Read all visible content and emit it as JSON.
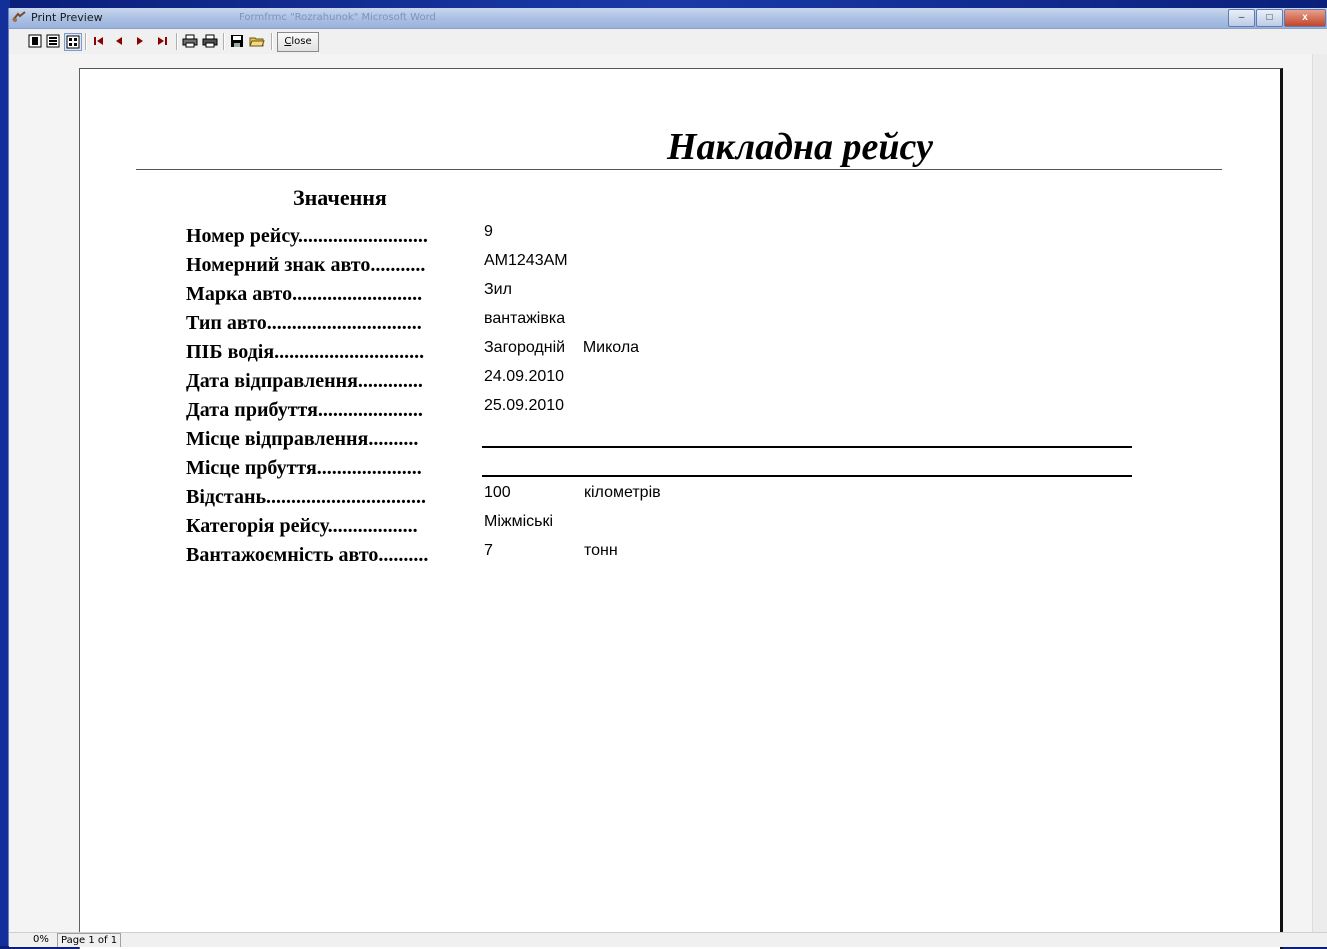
{
  "window": {
    "title": "Print Preview",
    "background_title": "Formfrmc \"Rozrahunok\" Microsoft Word",
    "minimize_label": "–",
    "maximize_label": "□",
    "close_label": "x"
  },
  "toolbar": {
    "close_label_first": "C",
    "close_label_rest": "lose"
  },
  "report": {
    "title": "Накладна рейсу",
    "section_heading": "Значення",
    "fields": [
      {
        "label": "Номер рейсу..........................",
        "value": "9",
        "unit": ""
      },
      {
        "label": "Номерний знак авто...........",
        "value": "АМ1243АМ",
        "unit": ""
      },
      {
        "label": "Марка авто..........................",
        "value": "Зил",
        "unit": ""
      },
      {
        "label": "Тип авто...............................",
        "value": "вантажівка",
        "unit": ""
      },
      {
        "label": "ПІБ водія..............................",
        "value": "Загородній    Микола",
        "unit": ""
      },
      {
        "label": "Дата відправлення.............",
        "value": "24.09.2010",
        "unit": ""
      },
      {
        "label": "Дата прибуття.....................",
        "value": "25.09.2010",
        "unit": ""
      },
      {
        "label": "Місце відправлення..........",
        "value": "",
        "unit": ""
      },
      {
        "label": "Місце прбуття.....................",
        "value": "",
        "unit": ""
      },
      {
        "label": "Відстань................................",
        "value": "100",
        "unit": "кілометрів"
      },
      {
        "label": "Категорія рейсу..................",
        "value": "Міжміські",
        "unit": ""
      },
      {
        "label": "Вантажоємність авто..........",
        "value": "7",
        "unit": "тонн"
      }
    ]
  },
  "statusbar": {
    "zoom": "0%",
    "page_info": "Page 1 of 1"
  }
}
